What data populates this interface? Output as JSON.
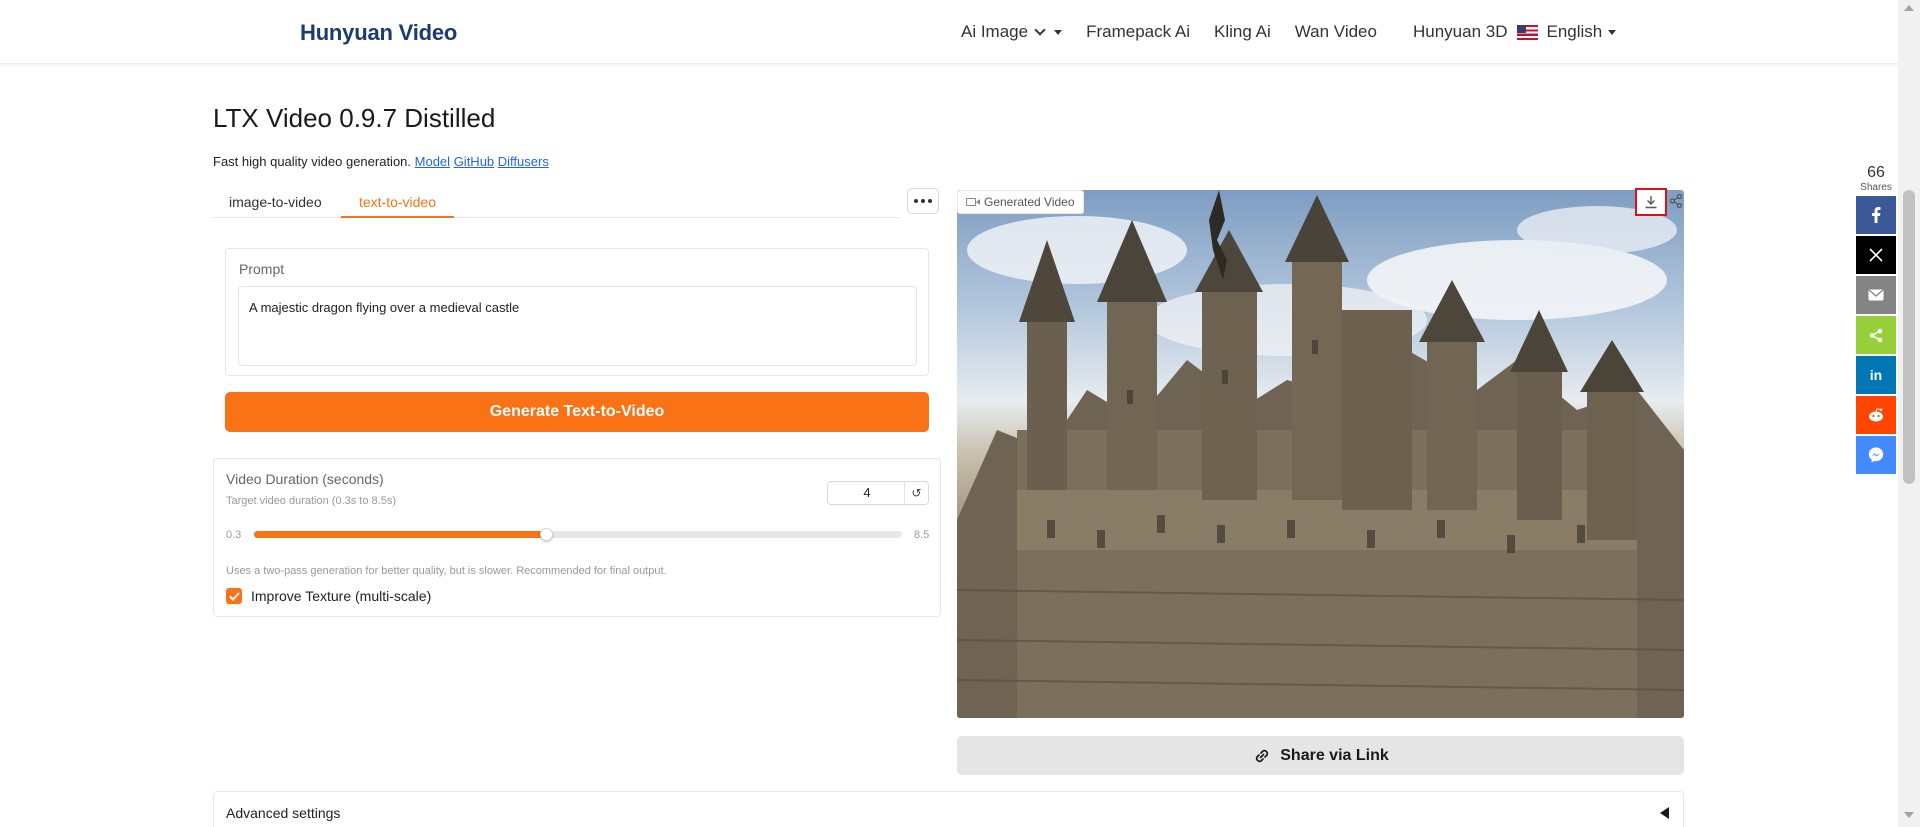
{
  "header": {
    "brand": "Hunyuan Video",
    "nav": [
      {
        "label": "Ai Image"
      },
      {
        "label": "Framepack Ai"
      },
      {
        "label": "Kling Ai"
      },
      {
        "label": "Wan Video"
      },
      {
        "label": "Hunyuan 3D"
      }
    ],
    "language": "English"
  },
  "page": {
    "title": "LTX Video 0.9.7 Distilled",
    "description": "Fast high quality video generation.",
    "links": [
      "Model",
      "GitHub",
      "Diffusers"
    ]
  },
  "tabs": [
    {
      "label": "image-to-video",
      "active": false
    },
    {
      "label": "text-to-video",
      "active": true
    }
  ],
  "prompt": {
    "label": "Prompt",
    "value": "A majestic dragon flying over a medieval castle"
  },
  "generate_button": "Generate Text-to-Video",
  "duration": {
    "title": "Video Duration (seconds)",
    "hint": "Target video duration (0.3s to 8.5s)",
    "value": "4",
    "min": "0.3",
    "max": "8.5",
    "slider_fraction": 0.451,
    "note": "Uses a two-pass generation for better quality, but is slower. Recommended for final output.",
    "checkbox_label": "Improve Texture (multi-scale)",
    "checkbox_checked": true
  },
  "video": {
    "label": "Generated Video",
    "icons": [
      "download-icon",
      "share-icon"
    ]
  },
  "share_link_button": "Share via Link",
  "advanced": {
    "label": "Advanced settings"
  },
  "share_sidebar": {
    "count": "66",
    "count_label": "Shares",
    "buttons": [
      {
        "name": "facebook",
        "color": "#3b5998"
      },
      {
        "name": "x",
        "color": "#000000"
      },
      {
        "name": "email",
        "color": "#848484"
      },
      {
        "name": "sharethis",
        "color": "#95d03a"
      },
      {
        "name": "linkedin",
        "color": "#0077b5"
      },
      {
        "name": "reddit",
        "color": "#ff4500"
      },
      {
        "name": "messenger",
        "color": "#448aff"
      }
    ]
  },
  "colors": {
    "accent": "#f97316",
    "brand": "#1e3a6e",
    "link": "#2563eb"
  }
}
